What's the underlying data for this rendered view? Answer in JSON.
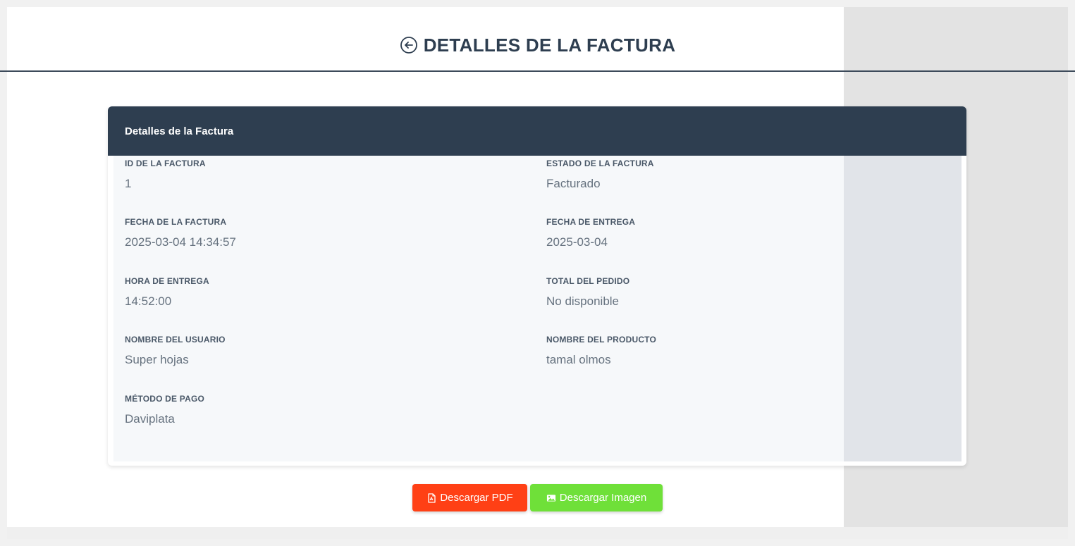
{
  "header": {
    "title": "DETALLES DE LA FACTURA",
    "back_icon": "back-arrow-circle-icon"
  },
  "card": {
    "title": "Detalles de la Factura",
    "fields": [
      {
        "label": "ID DE LA FACTURA",
        "value": "1"
      },
      {
        "label": "ESTADO DE LA FACTURA",
        "value": "Facturado"
      },
      {
        "label": "FECHA DE LA FACTURA",
        "value": "2025-03-04 14:34:57"
      },
      {
        "label": "FECHA DE ENTREGA",
        "value": "2025-03-04"
      },
      {
        "label": "HORA DE ENTREGA",
        "value": "14:52:00"
      },
      {
        "label": "TOTAL DEL PEDIDO",
        "value": "No disponible"
      },
      {
        "label": "NOMBRE DEL USUARIO",
        "value": "Super hojas"
      },
      {
        "label": "NOMBRE DEL PRODUCTO",
        "value": "tamal olmos"
      },
      {
        "label": "MÉTODO DE PAGO",
        "value": "Daviplata"
      }
    ]
  },
  "actions": {
    "pdf_label": "Descargar PDF",
    "pdf_icon": "file-pdf-icon",
    "image_label": "Descargar Imagen",
    "image_icon": "image-icon"
  },
  "colors": {
    "primary_dark": "#2e3e50",
    "pdf_button": "#ff4015",
    "image_button": "#6fe039",
    "card_body": "#f6f8fa"
  }
}
